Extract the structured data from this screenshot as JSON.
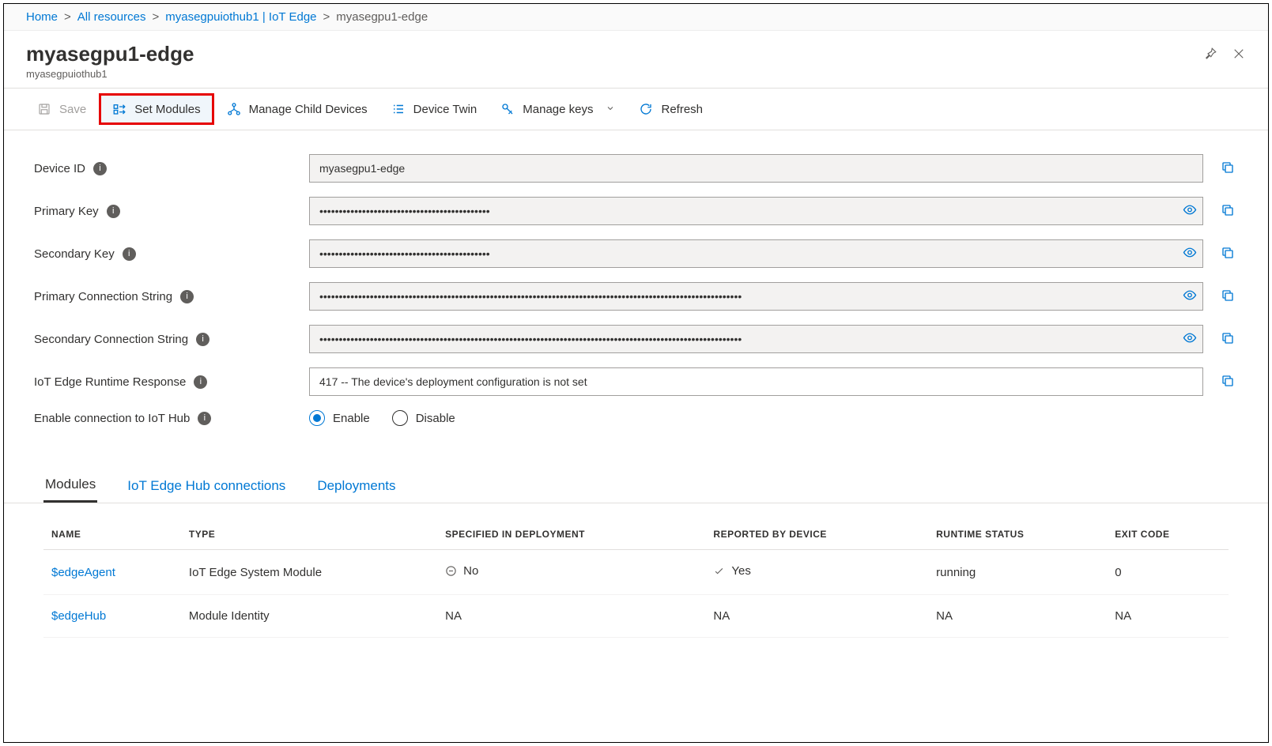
{
  "breadcrumb": {
    "items": [
      "Home",
      "All resources",
      "myasegpuiothub1 | IoT Edge"
    ],
    "current": "myasegpu1-edge"
  },
  "header": {
    "title": "myasegpu1-edge",
    "subtitle": "myasegpuiothub1"
  },
  "toolbar": {
    "save": "Save",
    "set_modules": "Set Modules",
    "manage_child": "Manage Child Devices",
    "device_twin": "Device Twin",
    "manage_keys": "Manage keys",
    "refresh": "Refresh"
  },
  "props": {
    "device_id": {
      "label": "Device ID",
      "value": "myasegpu1-edge"
    },
    "primary_key": {
      "label": "Primary Key",
      "value": "••••••••••••••••••••••••••••••••••••••••••••"
    },
    "secondary_key": {
      "label": "Secondary Key",
      "value": "••••••••••••••••••••••••••••••••••••••••••••"
    },
    "primary_conn": {
      "label": "Primary Connection String",
      "value": "•••••••••••••••••••••••••••••••••••••••••••••••••••••••••••••••••••••••••••••••••••••••••••••••••••••••••••••"
    },
    "secondary_conn": {
      "label": "Secondary Connection String",
      "value": "•••••••••••••••••••••••••••••••••••••••••••••••••••••••••••••••••••••••••••••••••••••••••••••••••••••••••••••"
    },
    "runtime_response": {
      "label": "IoT Edge Runtime Response",
      "value": "417 -- The device's deployment configuration is not set"
    },
    "enable_conn": {
      "label": "Enable connection to IoT Hub",
      "enable": "Enable",
      "disable": "Disable"
    }
  },
  "tabs": {
    "modules": "Modules",
    "connections": "IoT Edge Hub connections",
    "deployments": "Deployments"
  },
  "table": {
    "headers": {
      "name": "NAME",
      "type": "TYPE",
      "specified": "SPECIFIED IN DEPLOYMENT",
      "reported": "REPORTED BY DEVICE",
      "status": "RUNTIME STATUS",
      "exit": "EXIT CODE"
    },
    "rows": [
      {
        "name": "$edgeAgent",
        "type": "IoT Edge System Module",
        "specified": "No",
        "reported": "Yes",
        "status": "running",
        "exit": "0"
      },
      {
        "name": "$edgeHub",
        "type": "Module Identity",
        "specified": "NA",
        "reported": "NA",
        "status": "NA",
        "exit": "NA"
      }
    ]
  }
}
